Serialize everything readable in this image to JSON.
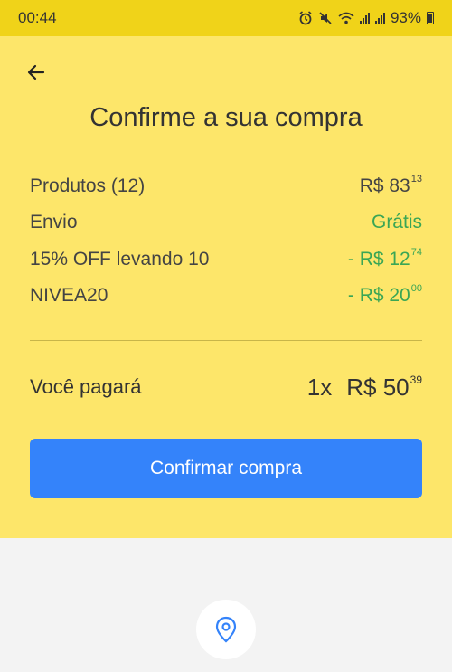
{
  "status_bar": {
    "time": "00:44",
    "battery": "93%",
    "icons": [
      "alarm-icon",
      "mute-icon",
      "wifi-icon",
      "signal-icon",
      "signal-icon",
      "battery-icon"
    ]
  },
  "header": {
    "back_icon": "arrow-left-icon",
    "title": "Confirme a sua compra"
  },
  "summary": {
    "rows": [
      {
        "label": "Produtos (12)",
        "amount": "R$ 83",
        "cents": "13",
        "color": "#444444"
      },
      {
        "label": "Envio",
        "amount": "Grátis",
        "cents": "",
        "color": "#3aa655"
      },
      {
        "label": "15% OFF levando 10",
        "amount": "- R$ 12",
        "cents": "74",
        "color": "#3aa655"
      },
      {
        "label": "NIVEA20",
        "amount": "- R$ 20",
        "cents": "00",
        "color": "#3aa655"
      }
    ]
  },
  "total": {
    "label": "Você pagará",
    "installments": "1x",
    "amount": "R$ 50",
    "cents": "39"
  },
  "confirm_button": {
    "label": "Confirmar compra",
    "color": "#3483fa"
  },
  "footer": {
    "icon": "location-pin-icon"
  },
  "colors": {
    "status_bar": "#f0d319",
    "panel": "#fde66a",
    "background": "#f3f3f3",
    "accent_green": "#3aa655"
  }
}
